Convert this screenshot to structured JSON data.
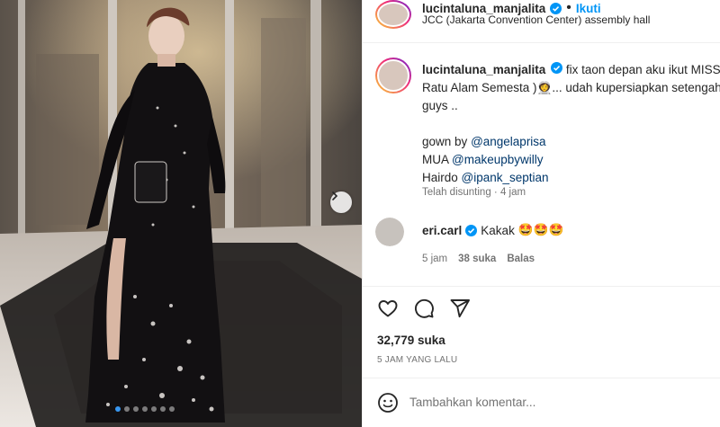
{
  "post": {
    "author": {
      "username": "lucintaluna_manjalita",
      "verified": true,
      "location": "JCC (Jakarta Convention Center) assembly hall",
      "follow_separator": "•",
      "follow_label": "Ikuti"
    },
    "caption": {
      "line1": "fix taon depan aku ikut MISS (",
      "line2": "Ratu Alam Semesta )",
      "emoji_astronaut": "👩‍🚀",
      "line2_tail": "... udah kupersiapkan setengah",
      "line3": "guys ..",
      "credit_gown_label": "gown by",
      "credit_gown_handle": "@angelaprisa",
      "credit_mua_label": "MUA",
      "credit_mua_handle": "@makeupbywilly",
      "credit_hair_label": "Hairdo",
      "credit_hair_handle": "@ipank_septian",
      "meta": "Telah disunting · 4 jam"
    },
    "comment": {
      "username": "eri.carl",
      "verified": true,
      "text": "Kakak",
      "emojis": "🤩🤩🤩",
      "time": "5 jam",
      "likes": "38 suka",
      "reply_label": "Balas"
    },
    "likes_count": "32,779 suka",
    "posted_time": "5 JAM YANG LALU",
    "add_comment_placeholder": "Tambahkan komentar...",
    "carousel": {
      "slides": 7,
      "active_index": 0
    }
  },
  "colors": {
    "accent_blue": "#0095f6",
    "verified_blue": "#0095f6",
    "text_primary": "#262626",
    "text_secondary": "#737373",
    "mention": "#00376b",
    "carousel_active": "#3897f0"
  },
  "icons": {
    "verified": "verified-badge-icon",
    "like": "heart-outline-icon",
    "comment": "comment-bubble-icon",
    "share": "paper-plane-icon",
    "emoji": "smiley-icon",
    "next": "chevron-right-icon"
  }
}
